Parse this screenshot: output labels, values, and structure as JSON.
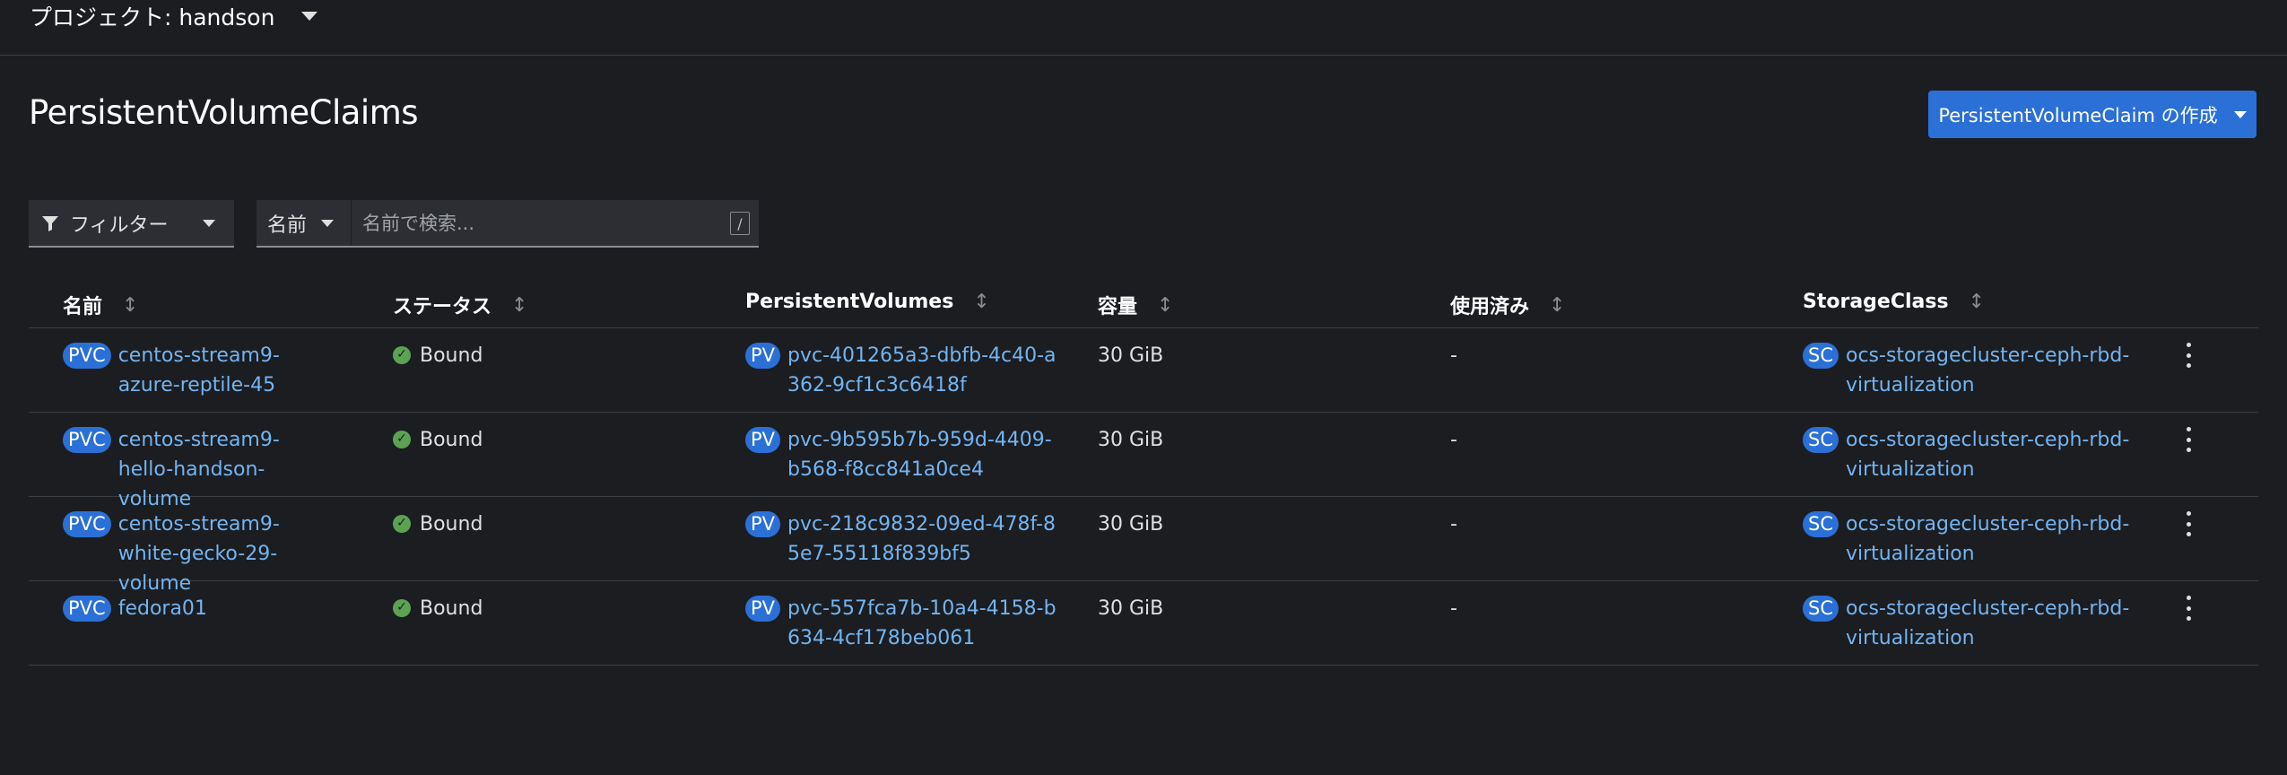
{
  "project_bar": {
    "label": "プロジェクト: handson"
  },
  "page": {
    "title": "PersistentVolumeClaims",
    "create_button": "PersistentVolumeClaim の作成"
  },
  "toolbar": {
    "filter_label": "フィルター",
    "attribute_label": "名前",
    "search_placeholder": "名前で検索...",
    "shortcut_hint": "/"
  },
  "table": {
    "headers": {
      "name": "名前",
      "status": "ステータス",
      "pv": "PersistentVolumes",
      "capacity": "容量",
      "used": "使用済み",
      "storage_class": "StorageClass"
    },
    "badges": {
      "pvc": "PVC",
      "pv": "PV",
      "sc": "SC"
    },
    "rows": [
      {
        "name": "centos-stream9-azure-reptile-45",
        "status": "Bound",
        "pv": "pvc-401265a3-dbfb-4c40-a362-9cf1c3c6418f",
        "capacity": "30 GiB",
        "used": "-",
        "storage_class": "ocs-storagecluster-ceph-rbd-virtualization"
      },
      {
        "name": "centos-stream9-hello-handson-volume",
        "status": "Bound",
        "pv": "pvc-9b595b7b-959d-4409-b568-f8cc841a0ce4",
        "capacity": "30 GiB",
        "used": "-",
        "storage_class": "ocs-storagecluster-ceph-rbd-virtualization"
      },
      {
        "name": "centos-stream9-white-gecko-29-volume",
        "status": "Bound",
        "pv": "pvc-218c9832-09ed-478f-85e7-55118f839bf5",
        "capacity": "30 GiB",
        "used": "-",
        "storage_class": "ocs-storagecluster-ceph-rbd-virtualization"
      },
      {
        "name": "fedora01",
        "status": "Bound",
        "pv": "pvc-557fca7b-10a4-4158-b634-4cf178beb061",
        "capacity": "30 GiB",
        "used": "-",
        "storage_class": "ocs-storagecluster-ceph-rbd-virtualization"
      }
    ]
  },
  "colors": {
    "background": "#1b1d21",
    "primary_button": "#2b70d6",
    "link": "#73b4f0",
    "status_ok": "#5ba352"
  }
}
